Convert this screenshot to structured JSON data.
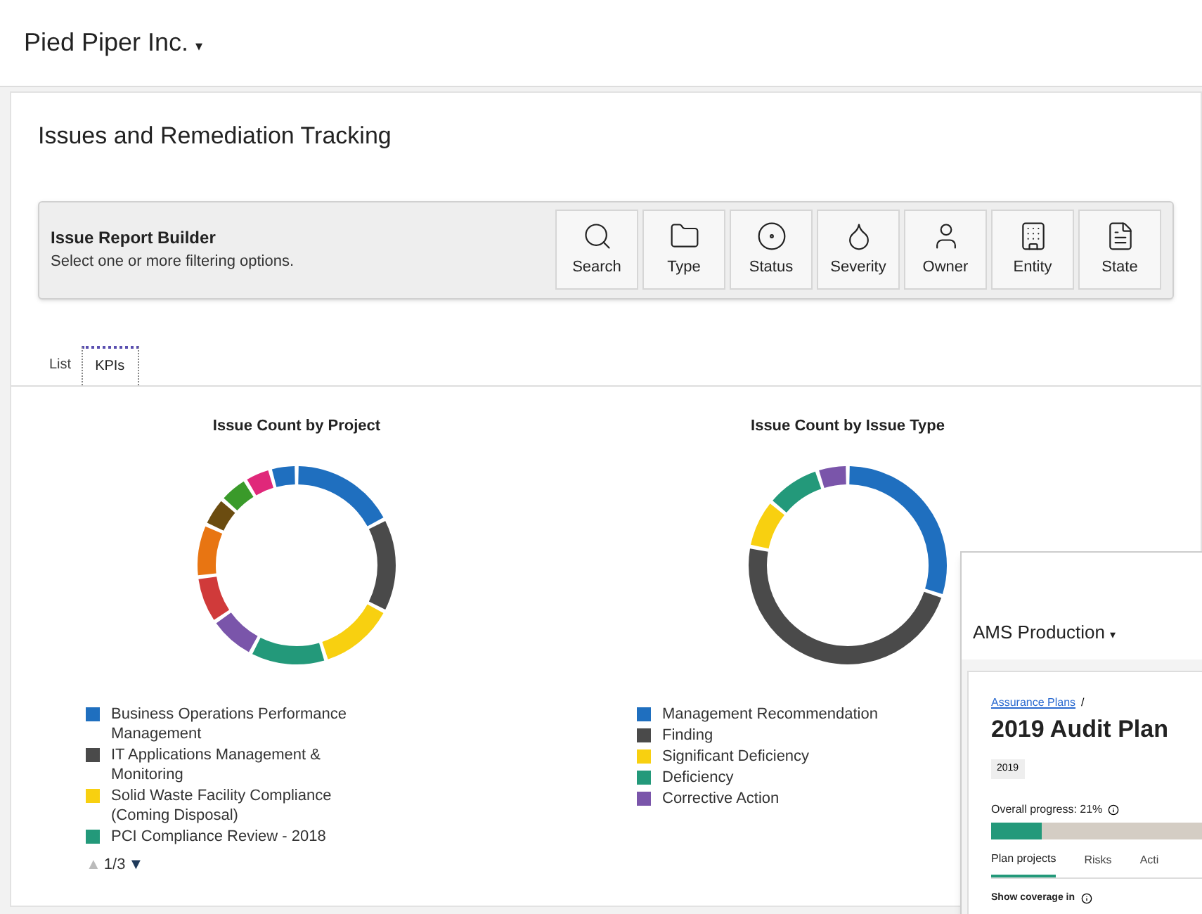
{
  "header": {
    "org": "Pied Piper Inc.",
    "caret": "▾"
  },
  "page": {
    "title": "Issues and Remediation Tracking"
  },
  "report_builder": {
    "title": "Issue Report Builder",
    "subtitle": "Select one or more filtering options.",
    "filters": [
      {
        "kind": "search",
        "label": "Search"
      },
      {
        "kind": "type",
        "label": "Type"
      },
      {
        "kind": "status",
        "label": "Status"
      },
      {
        "kind": "severity",
        "label": "Severity"
      },
      {
        "kind": "owner",
        "label": "Owner"
      },
      {
        "kind": "entity",
        "label": "Entity"
      },
      {
        "kind": "state",
        "label": "State"
      }
    ]
  },
  "tabs": [
    {
      "label": "List",
      "selected": false
    },
    {
      "label": "KPIs",
      "selected": true
    }
  ],
  "charts": [
    {
      "kind": "project",
      "title": "Issue Count by Project",
      "legend": [
        {
          "label": "Business Operations Performance Management",
          "color": "#1f6fbf"
        },
        {
          "label": "IT Applications Management & Monitoring",
          "color": "#4a4a4a"
        },
        {
          "label": "Solid Waste Facility Compliance (Coming Disposal)",
          "color": "#f8d010"
        },
        {
          "label": "PCI Compliance Review - 2018",
          "color": "#23997a"
        }
      ],
      "pager": {
        "up": "▲",
        "page": "1/3",
        "down": "▼"
      }
    },
    {
      "kind": "type",
      "title": "Issue Count by Issue Type",
      "legend": [
        {
          "label": "Management Recommendation",
          "color": "#1f6fbf"
        },
        {
          "label": "Finding",
          "color": "#4a4a4a"
        },
        {
          "label": "Significant Deficiency",
          "color": "#f8d010"
        },
        {
          "label": "Deficiency",
          "color": "#23997a"
        },
        {
          "label": "Corrective Action",
          "color": "#7a55aa"
        }
      ]
    }
  ],
  "overlay": {
    "org": "AMS Production",
    "caret": "▾",
    "breadcrumb": "Assurance Plans",
    "separator": "/",
    "title": "2019 Audit Plan",
    "tag": "2019",
    "progress_label": "Overall progress: 21%",
    "progress": {
      "level": 0.21
    },
    "tabs": [
      {
        "label": "Plan projects",
        "selected": true
      },
      {
        "label": "Risks",
        "selected": false
      },
      {
        "label": "Acti",
        "selected": false
      }
    ],
    "coverage_label": "Show coverage in"
  }
}
